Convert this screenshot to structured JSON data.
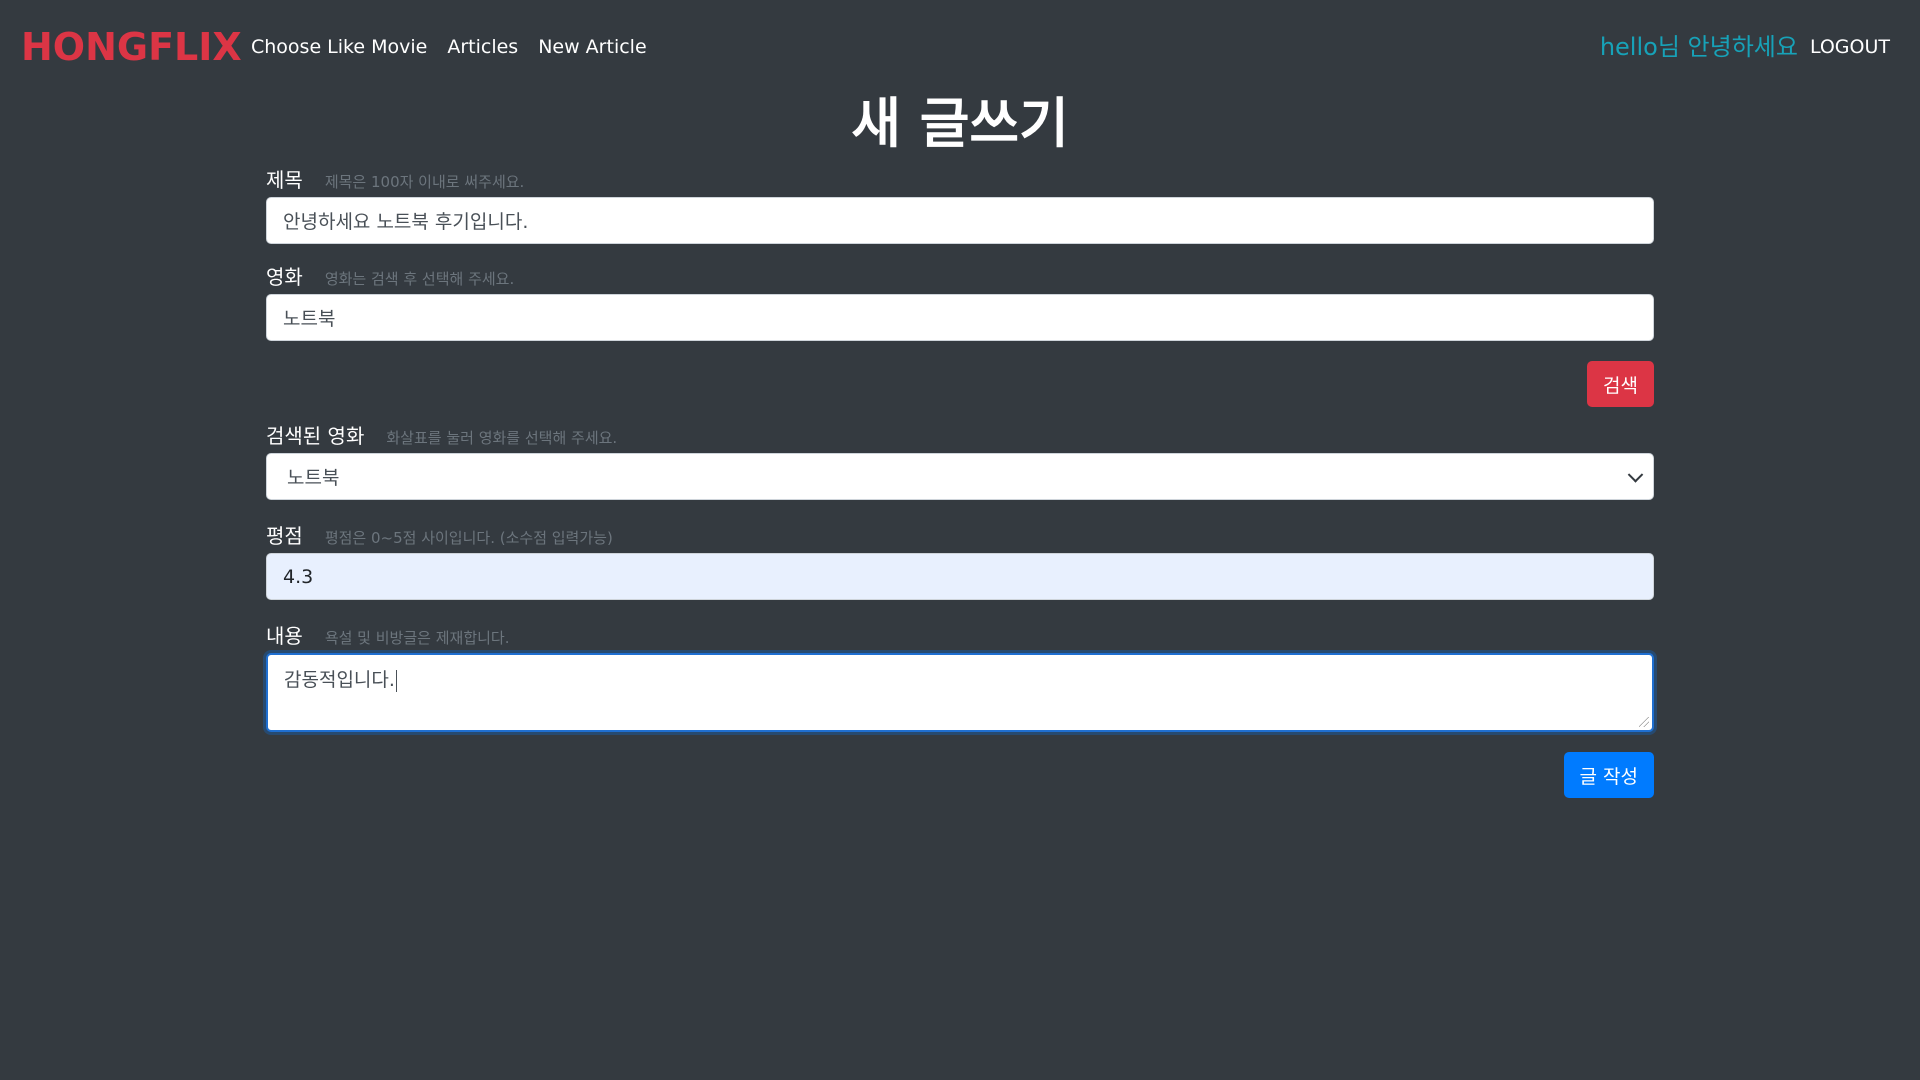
{
  "navbar": {
    "brand": "HONGFLIX",
    "links": [
      "Choose Like Movie",
      "Articles",
      "New Article"
    ],
    "greeting": "hello님 안녕하세요",
    "logout": "LOGOUT"
  },
  "page": {
    "title": "새 글쓰기"
  },
  "form": {
    "title_field": {
      "label": "제목",
      "help": "제목은 100자 이내로 써주세요.",
      "value": "안녕하세요 노트북 후기입니다."
    },
    "movie_field": {
      "label": "영화",
      "help": "영화는 검색 후 선택해 주세요.",
      "value": "노트북"
    },
    "search_button": "검색",
    "searched_movie_field": {
      "label": "검색된 영화",
      "help": "화살표를 눌러 영화를 선택해 주세요.",
      "selected": "노트북"
    },
    "rating_field": {
      "label": "평점",
      "help": "평점은 0~5점 사이입니다. (소수점 입력가능)",
      "value": "4.3"
    },
    "content_field": {
      "label": "내용",
      "help": "욕설 및 비방글은 제재합니다.",
      "value": "감동적입니다."
    },
    "submit_button": "글 작성"
  },
  "colors": {
    "background": "#343a40",
    "brand": "#dc3545",
    "greeting": "#17a2b8",
    "danger": "#dc3545",
    "primary": "#007bff",
    "help_text": "#6c757d"
  }
}
